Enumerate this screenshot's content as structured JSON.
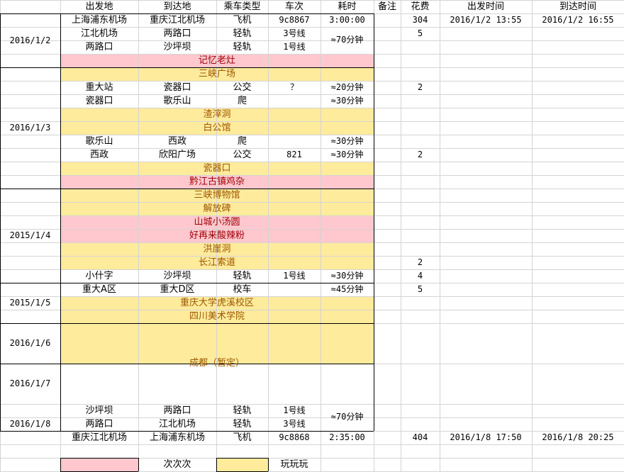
{
  "colors": {
    "yellow_fill": "#ffeb9c",
    "pink_fill": "#ffc7ce",
    "yellow_text": "#9c5700",
    "pink_text": "#9c0006",
    "gridline": "#d4d4d4",
    "border": "#000000"
  },
  "headers": [
    "出发地",
    "到达地",
    "乘车类型",
    "车次",
    "耗时",
    "备注",
    "花费",
    "出发时间",
    "到达时间"
  ],
  "dates": {
    "d1": "2016/1/2",
    "d2": "2016/1/3",
    "d3": "2015/1/4",
    "d4": "2015/1/5",
    "d5": "2016/1/6",
    "d6": "2016/1/7",
    "d7": "2016/1/8"
  },
  "rows": [
    {
      "from": "上海浦东机场",
      "to": "重庆江北机场",
      "type": "飞机",
      "no": "9c8867",
      "dur": "3:00:00",
      "cost": "304",
      "dep": "2016/1/2 13:55",
      "arr": "2016/1/2 16:55"
    },
    {
      "from": "江北机场",
      "to": "两路口",
      "type": "轻轨",
      "no": "3号线",
      "dur": "≈70分钟",
      "cost": "5"
    },
    {
      "from": "两路口",
      "to": "沙坪坝",
      "type": "轻轨",
      "no": "1号线"
    },
    {
      "band": "记忆老灶"
    },
    {
      "band": "三峡广场"
    },
    {
      "from": "重大站",
      "to": "瓷器口",
      "type": "公交",
      "no": "？",
      "dur": "≈20分钟",
      "cost": "2"
    },
    {
      "from": "瓷器口",
      "to": "歌乐山",
      "type": "爬",
      "no": "",
      "dur": "≈30分钟"
    },
    {
      "band": "渣滓洞"
    },
    {
      "band": "白公馆"
    },
    {
      "from": "歌乐山",
      "to": "西政",
      "type": "爬",
      "no": "",
      "dur": "≈30分钟"
    },
    {
      "from": "西政",
      "to": "欣阳广场",
      "type": "公交",
      "no": "821",
      "dur": "≈30分钟",
      "cost": "2"
    },
    {
      "band": "瓷器口"
    },
    {
      "band": "黔江古镇鸡杂"
    },
    {
      "band": "三峡博物馆"
    },
    {
      "band": "解放碑"
    },
    {
      "band": "山城小汤圆"
    },
    {
      "band": "好再来酸辣粉"
    },
    {
      "band": "洪崖洞"
    },
    {
      "band": "长江索道",
      "cost": "2"
    },
    {
      "from": "小什字",
      "to": "沙坪坝",
      "type": "轻轨",
      "no": "1号线",
      "dur": "≈30分钟",
      "cost": "4"
    },
    {
      "from": "重大A区",
      "to": "重大D区",
      "type": "校车",
      "no": "",
      "dur": "≈45分钟",
      "cost": "5"
    },
    {
      "band": "重庆大学虎溪校区"
    },
    {
      "band": "四川美术学院"
    },
    {
      "band": "成都（暂定）"
    },
    {
      "from": "沙坪坝",
      "to": "两路口",
      "type": "轻轨",
      "no": "1号线",
      "dur": "≈70分钟"
    },
    {
      "from": "两路口",
      "to": "江北机场",
      "type": "轻轨",
      "no": "3号线"
    },
    {
      "from": "重庆江北机场",
      "to": "上海浦东机场",
      "type": "飞机",
      "no": "9c8868",
      "dur": "2:35:00",
      "cost": "404",
      "dep": "2016/1/8 17:50",
      "arr": "2016/1/8 20:25"
    }
  ],
  "legend": {
    "pink_label": "次次次",
    "yellow_label": "玩玩玩"
  }
}
